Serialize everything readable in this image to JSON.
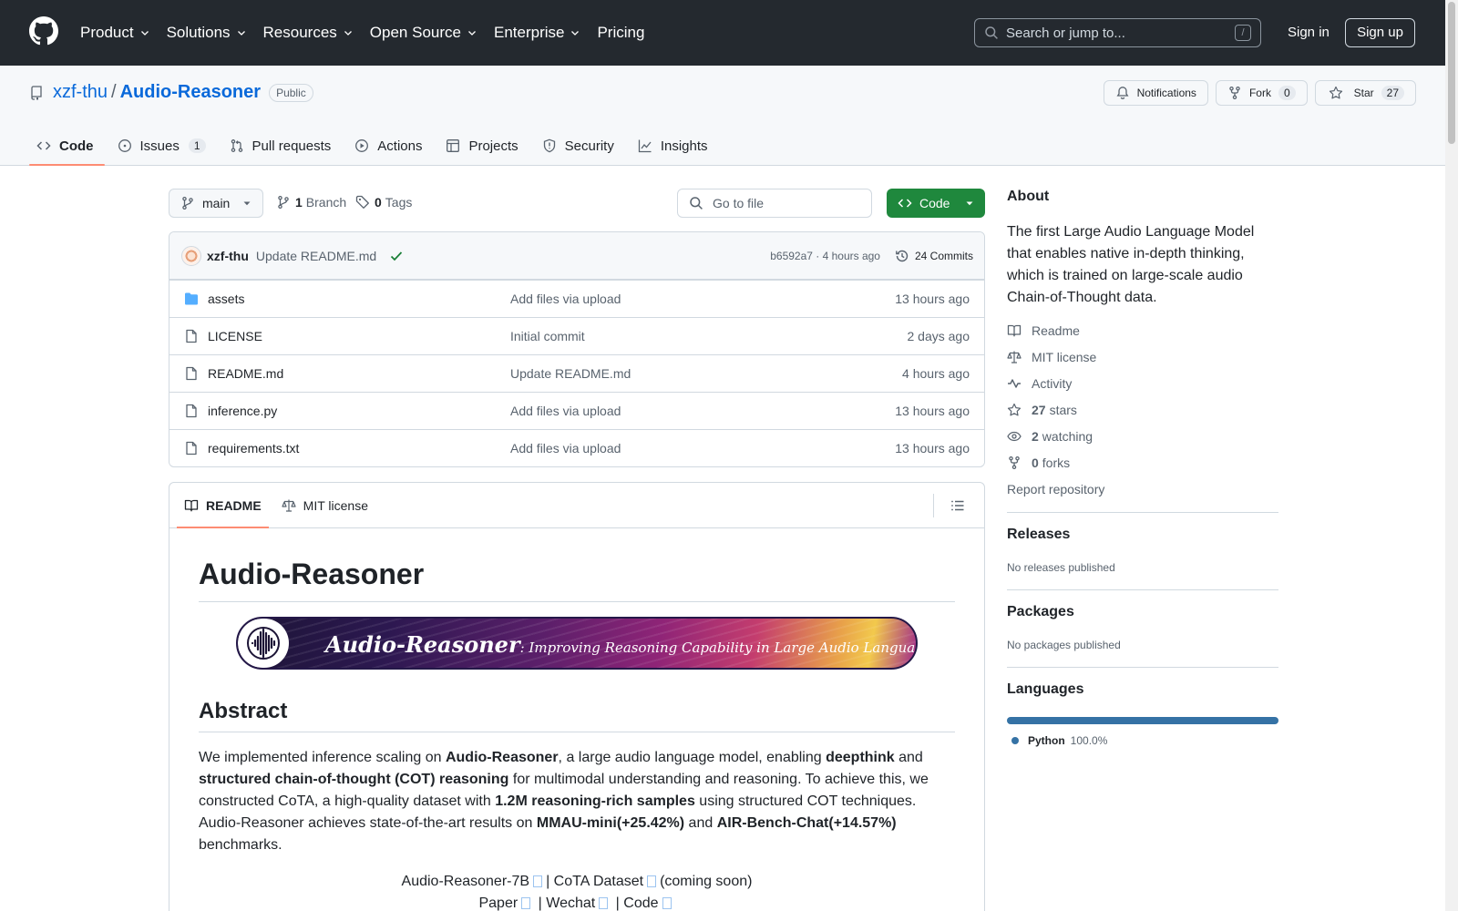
{
  "header": {
    "nav": [
      "Product",
      "Solutions",
      "Resources",
      "Open Source",
      "Enterprise"
    ],
    "pricing": "Pricing",
    "search_placeholder": "Search or jump to...",
    "search_shortcut": "/",
    "sign_in": "Sign in",
    "sign_up": "Sign up"
  },
  "repo": {
    "owner": "xzf-thu",
    "separator": "/",
    "name": "Audio-Reasoner",
    "visibility": "Public",
    "notifications": "Notifications",
    "fork_label": "Fork",
    "fork_count": "0",
    "star_label": "Star",
    "star_count": "27"
  },
  "tabs": [
    {
      "label": "Code",
      "active": true
    },
    {
      "label": "Issues",
      "count": "1"
    },
    {
      "label": "Pull requests"
    },
    {
      "label": "Actions"
    },
    {
      "label": "Projects"
    },
    {
      "label": "Security"
    },
    {
      "label": "Insights"
    }
  ],
  "toolbar": {
    "branch": "main",
    "branch_count": "1",
    "branch_label": "Branch",
    "tag_count": "0",
    "tag_label": "Tags",
    "goto_placeholder": "Go to file",
    "code_label": "Code"
  },
  "commit": {
    "author": "xzf-thu",
    "message": "Update README.md",
    "sha_time": "b6592a7 · 4 hours ago",
    "commits": "24 Commits"
  },
  "files": [
    {
      "name": "assets",
      "type": "folder",
      "message": "Add files via upload",
      "date": "13 hours ago"
    },
    {
      "name": "LICENSE",
      "type": "file",
      "message": "Initial commit",
      "date": "2 days ago"
    },
    {
      "name": "README.md",
      "type": "file",
      "message": "Update README.md",
      "date": "4 hours ago"
    },
    {
      "name": "inference.py",
      "type": "file",
      "message": "Add files via upload",
      "date": "13 hours ago"
    },
    {
      "name": "requirements.txt",
      "type": "file",
      "message": "Add files via upload",
      "date": "13 hours ago"
    }
  ],
  "readme": {
    "tab_readme": "README",
    "tab_license": "MIT license",
    "title": "Audio-Reasoner",
    "banner_title": "Audio-Reasoner",
    "banner_subtitle": ": Improving Reasoning Capability in Large Audio Language Models",
    "abstract_heading": "Abstract",
    "abstract": [
      {
        "t": "We implemented inference scaling on "
      },
      {
        "t": "Audio-Reasoner",
        "b": true
      },
      {
        "t": ", a large audio language model, enabling "
      },
      {
        "t": "deepthink",
        "b": true
      },
      {
        "t": " and "
      },
      {
        "t": "structured chain-of-thought (COT) reasoning",
        "b": true
      },
      {
        "t": " for multimodal understanding and reasoning. To achieve this, we constructed CoTA, a high-quality dataset with "
      },
      {
        "t": "1.2M reasoning-rich samples",
        "b": true
      },
      {
        "t": " using structured COT techniques. Audio-Reasoner achieves state-of-the-art results on "
      },
      {
        "t": "MMAU-mini(+25.42%)",
        "b": true
      },
      {
        "t": " and "
      },
      {
        "t": "AIR-Bench-Chat(+14.57%)",
        "b": true
      },
      {
        "t": " benchmarks."
      }
    ],
    "links_line1": [
      "Audio-Reasoner-7B",
      "| CoTA Dataset",
      "(coming soon)"
    ],
    "links_line2": [
      "Paper",
      "|",
      "Wechat",
      "|",
      "Code"
    ]
  },
  "about": {
    "heading": "About",
    "description": "The first Large Audio Language Model that enables native in-depth thinking, which is trained on large-scale audio Chain-of-Thought data.",
    "readme": "Readme",
    "license": "MIT license",
    "activity": "Activity",
    "stars_count": "27",
    "stars_label": "stars",
    "watching_count": "2",
    "watching_label": "watching",
    "forks_count": "0",
    "forks_label": "forks",
    "report": "Report repository"
  },
  "releases": {
    "heading": "Releases",
    "text": "No releases published"
  },
  "packages": {
    "heading": "Packages",
    "text": "No packages published"
  },
  "languages": {
    "heading": "Languages",
    "items": [
      {
        "name": "Python",
        "percent": "100.0%",
        "color": "#3572a5"
      }
    ]
  },
  "colors": {
    "header_bg": "#24292f",
    "link": "#0969da",
    "primary_button": "#1f883d",
    "tab_underline": "#fd8c73"
  }
}
